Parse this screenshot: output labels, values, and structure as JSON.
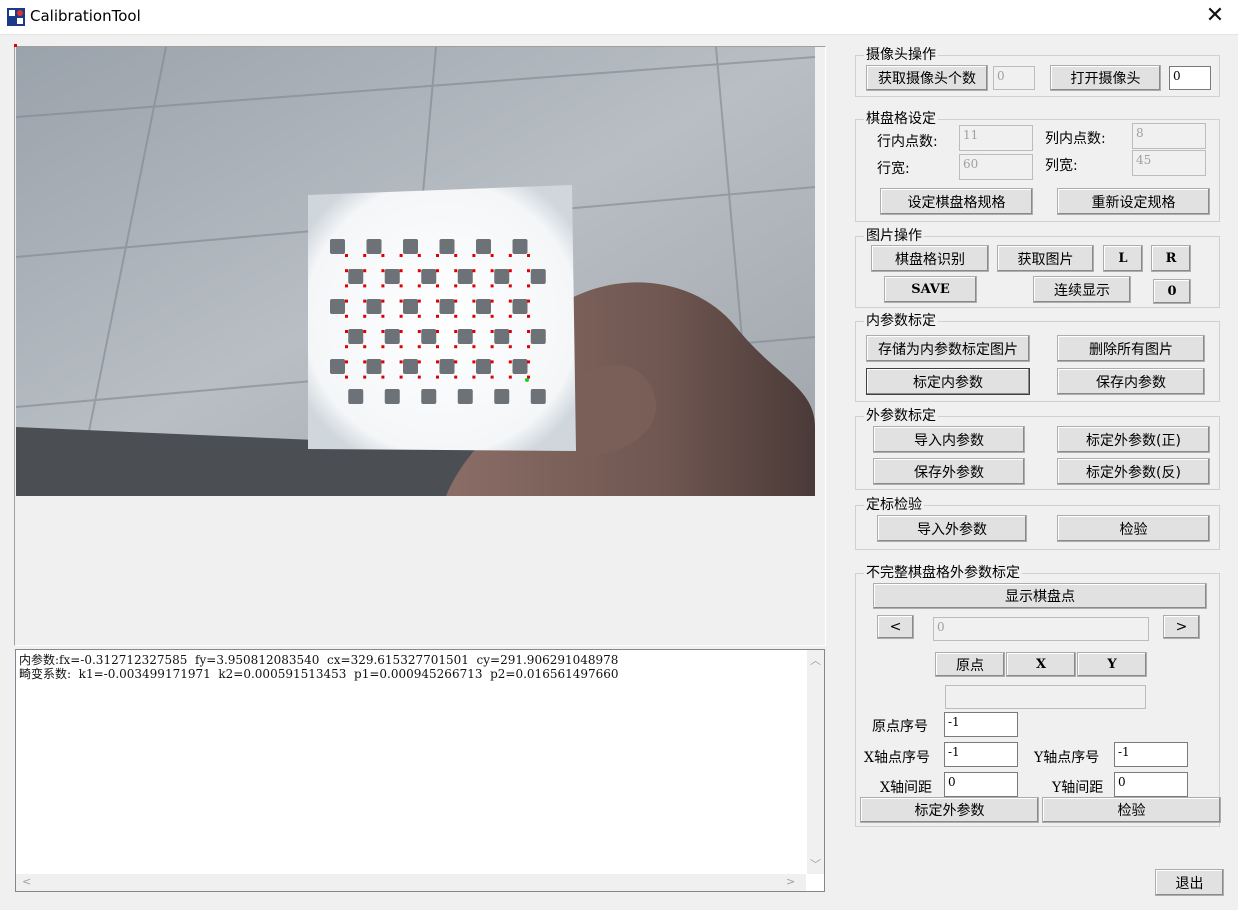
{
  "window": {
    "title": "CalibrationTool",
    "close_glyph": "✕"
  },
  "log": {
    "line1": "内参数:fx=-0.312712327585  fy=3.950812083540  cx=329.615327701501  cy=291.906291048978",
    "line2": "畸变系数:  k1=-0.003499171971  k2=0.000591513453  p1=0.000945266713  p2=0.016561497660"
  },
  "camera": {
    "title": "摄像头操作",
    "get_count_label": "获取摄像头个数",
    "count_value": "0",
    "open_label": "打开摄像头",
    "open_value": "0"
  },
  "board": {
    "title": "棋盘格设定",
    "row_points_label": "行内点数:",
    "row_points_value": "11",
    "col_points_label": "列内点数:",
    "col_points_value": "8",
    "row_width_label": "行宽:",
    "row_width_value": "60",
    "col_width_label": "列宽:",
    "col_width_value": "45",
    "set_label": "设定棋盘格规格",
    "reset_label": "重新设定规格"
  },
  "image_ops": {
    "title": "图片操作",
    "detect_label": "棋盘格识别",
    "get_image_label": "获取图片",
    "l_label": "L",
    "r_label": "R",
    "save_label": "SAVE",
    "continuous_label": "连续显示",
    "counter_label": "0"
  },
  "intrinsic": {
    "title": "内参数标定",
    "store_label": "存储为内参数标定图片",
    "delete_label": "删除所有图片",
    "calibrate_label": "标定内参数",
    "save_label": "保存内参数"
  },
  "extrinsic": {
    "title": "外参数标定",
    "import_label": "导入内参数",
    "cal_pos_label": "标定外参数(正)",
    "save_label": "保存外参数",
    "cal_neg_label": "标定外参数(反)"
  },
  "verify": {
    "title": "定标检验",
    "import_label": "导入外参数",
    "check_label": "检验"
  },
  "partial": {
    "title": "不完整棋盘格外参数标定",
    "show_points_label": "显示棋盘点",
    "prev_label": "<",
    "next_label": ">",
    "index_value": "0",
    "origin_label": "原点",
    "x_label": "X",
    "y_label": "Y",
    "origin_idx_label": "原点序号",
    "origin_idx_value": "-1",
    "x_idx_label": "X轴点序号",
    "x_idx_value": "-1",
    "y_idx_label": "Y轴点序号",
    "y_idx_value": "-1",
    "x_spacing_label": "X轴间距",
    "x_spacing_value": "0",
    "y_spacing_label": "Y轴间距",
    "y_spacing_value": "0",
    "calibrate_label": "标定外参数",
    "check_label": "检验"
  },
  "exit_label": "退出"
}
